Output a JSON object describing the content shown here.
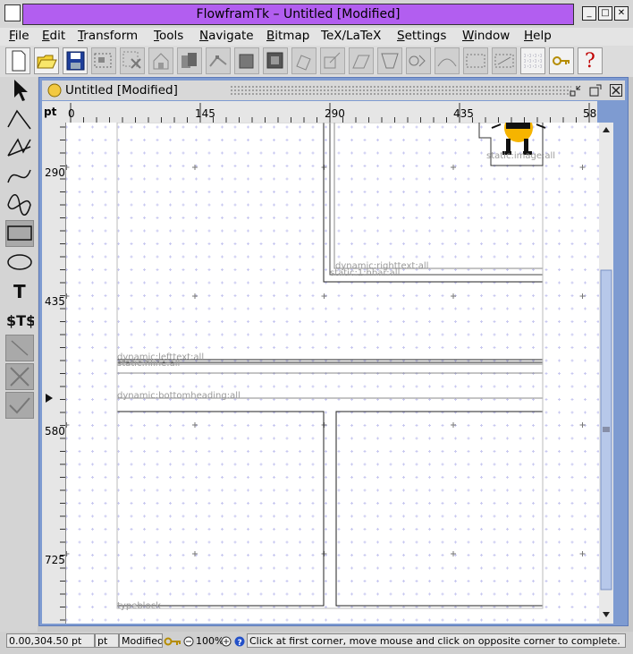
{
  "window": {
    "title": "FlowframTk – Untitled [Modified]",
    "min_label": "_",
    "max_label": "□",
    "close_label": "✕"
  },
  "menu": [
    {
      "label": "File",
      "u": "F",
      "rest": "ile"
    },
    {
      "label": "Edit",
      "u": "E",
      "rest": "dit"
    },
    {
      "label": "Transform",
      "u": "T",
      "rest": "ransform"
    },
    {
      "label": "Tools",
      "u": "T",
      "rest": "ools"
    },
    {
      "label": "Navigate",
      "u": "N",
      "rest": "avigate"
    },
    {
      "label": "Bitmap",
      "u": "B",
      "rest": "itmap"
    },
    {
      "label": "TeX/LaTeX",
      "u": "",
      "rest": "TeX/LaTeX"
    },
    {
      "label": "Settings",
      "u": "S",
      "rest": "ettings"
    },
    {
      "label": "Window",
      "u": "W",
      "rest": "indow"
    },
    {
      "label": "Help",
      "u": "H",
      "rest": "elp"
    }
  ],
  "toolbar": {
    "key_icon": "key-icon",
    "help_label": "?"
  },
  "document": {
    "title": "Untitled [Modified]"
  },
  "ruler": {
    "unit": "pt",
    "top_ticks": [
      "0",
      "145",
      "290",
      "435",
      "58"
    ],
    "left_ticks": [
      "290",
      "435",
      "580",
      "725"
    ]
  },
  "canvas": {
    "labels": {
      "static_image": "static:image:all",
      "dynamic_right": "dynamic:righttext:all",
      "static_hbar": "static:1:hbar:all",
      "dynamic_left": "dynamic:lefttext:all",
      "static_hline": "static:hline:all",
      "dynamic_bottom": "dynamic:bottomheading:all",
      "typeblock": "typeblock"
    },
    "grid_color": "#c8c8f0",
    "major_mark_color": "#777777"
  },
  "status": {
    "coords": "0.00,304.50 pt",
    "unit": "pt",
    "modified": "Modified",
    "zoom": "100%",
    "message": "Click at first corner, move mouse and click on opposite corner to complete."
  }
}
